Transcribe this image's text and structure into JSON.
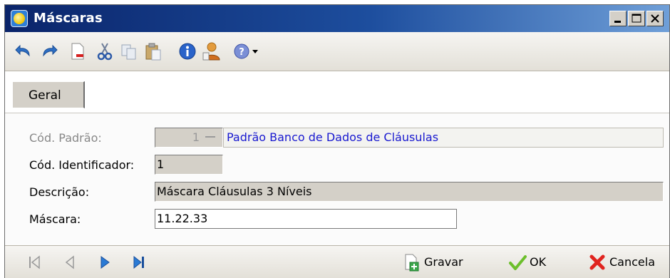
{
  "window": {
    "title": "Máscaras"
  },
  "toolbar": {
    "icons": [
      "undo-icon",
      "redo-icon",
      "new-document-icon",
      "cut-icon",
      "copy-icon",
      "paste-icon",
      "info-icon",
      "user-icon",
      "help-icon",
      "dropdown-arrow-icon"
    ]
  },
  "tabs": [
    {
      "label": "Geral"
    }
  ],
  "form": {
    "cod_padrao": {
      "label": "Cód. Padrão:",
      "value": "1",
      "description": "Padrão Banco de Dados de Cláusulas"
    },
    "cod_identificador": {
      "label": "Cód. Identificador:",
      "value": "1"
    },
    "descricao": {
      "label": "Descrição:",
      "value": "Máscara Cláusulas 3 Níveis"
    },
    "mascara": {
      "label": "Máscara:",
      "value": "11.22.33"
    }
  },
  "footer": {
    "gravar_label": "Gravar",
    "ok_label": "OK",
    "cancela_label": "Cancela"
  },
  "colors": {
    "title_bar": "#0a246a",
    "link_text": "#1a1ad0",
    "panel": "#d4d0c8"
  }
}
